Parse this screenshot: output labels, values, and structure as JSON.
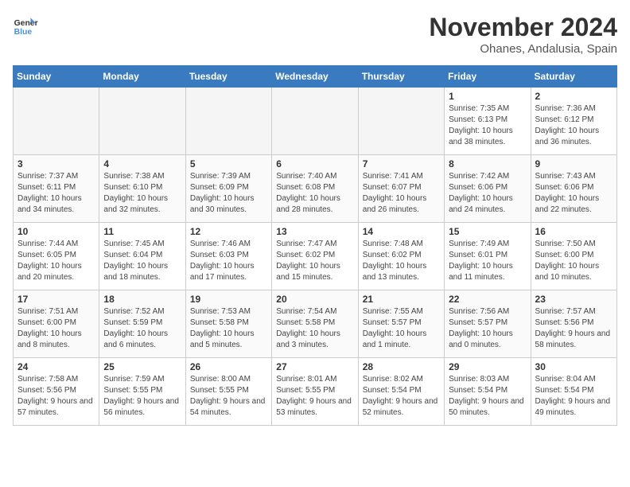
{
  "header": {
    "logo_general": "General",
    "logo_blue": "Blue",
    "month_title": "November 2024",
    "location": "Ohanes, Andalusia, Spain"
  },
  "days_of_week": [
    "Sunday",
    "Monday",
    "Tuesday",
    "Wednesday",
    "Thursday",
    "Friday",
    "Saturday"
  ],
  "weeks": [
    [
      {
        "day": "",
        "empty": true
      },
      {
        "day": "",
        "empty": true
      },
      {
        "day": "",
        "empty": true
      },
      {
        "day": "",
        "empty": true
      },
      {
        "day": "",
        "empty": true
      },
      {
        "day": "1",
        "sunrise": "7:35 AM",
        "sunset": "6:13 PM",
        "daylight": "10 hours and 38 minutes."
      },
      {
        "day": "2",
        "sunrise": "7:36 AM",
        "sunset": "6:12 PM",
        "daylight": "10 hours and 36 minutes."
      }
    ],
    [
      {
        "day": "3",
        "sunrise": "7:37 AM",
        "sunset": "6:11 PM",
        "daylight": "10 hours and 34 minutes."
      },
      {
        "day": "4",
        "sunrise": "7:38 AM",
        "sunset": "6:10 PM",
        "daylight": "10 hours and 32 minutes."
      },
      {
        "day": "5",
        "sunrise": "7:39 AM",
        "sunset": "6:09 PM",
        "daylight": "10 hours and 30 minutes."
      },
      {
        "day": "6",
        "sunrise": "7:40 AM",
        "sunset": "6:08 PM",
        "daylight": "10 hours and 28 minutes."
      },
      {
        "day": "7",
        "sunrise": "7:41 AM",
        "sunset": "6:07 PM",
        "daylight": "10 hours and 26 minutes."
      },
      {
        "day": "8",
        "sunrise": "7:42 AM",
        "sunset": "6:06 PM",
        "daylight": "10 hours and 24 minutes."
      },
      {
        "day": "9",
        "sunrise": "7:43 AM",
        "sunset": "6:06 PM",
        "daylight": "10 hours and 22 minutes."
      }
    ],
    [
      {
        "day": "10",
        "sunrise": "7:44 AM",
        "sunset": "6:05 PM",
        "daylight": "10 hours and 20 minutes."
      },
      {
        "day": "11",
        "sunrise": "7:45 AM",
        "sunset": "6:04 PM",
        "daylight": "10 hours and 18 minutes."
      },
      {
        "day": "12",
        "sunrise": "7:46 AM",
        "sunset": "6:03 PM",
        "daylight": "10 hours and 17 minutes."
      },
      {
        "day": "13",
        "sunrise": "7:47 AM",
        "sunset": "6:02 PM",
        "daylight": "10 hours and 15 minutes."
      },
      {
        "day": "14",
        "sunrise": "7:48 AM",
        "sunset": "6:02 PM",
        "daylight": "10 hours and 13 minutes."
      },
      {
        "day": "15",
        "sunrise": "7:49 AM",
        "sunset": "6:01 PM",
        "daylight": "10 hours and 11 minutes."
      },
      {
        "day": "16",
        "sunrise": "7:50 AM",
        "sunset": "6:00 PM",
        "daylight": "10 hours and 10 minutes."
      }
    ],
    [
      {
        "day": "17",
        "sunrise": "7:51 AM",
        "sunset": "6:00 PM",
        "daylight": "10 hours and 8 minutes."
      },
      {
        "day": "18",
        "sunrise": "7:52 AM",
        "sunset": "5:59 PM",
        "daylight": "10 hours and 6 minutes."
      },
      {
        "day": "19",
        "sunrise": "7:53 AM",
        "sunset": "5:58 PM",
        "daylight": "10 hours and 5 minutes."
      },
      {
        "day": "20",
        "sunrise": "7:54 AM",
        "sunset": "5:58 PM",
        "daylight": "10 hours and 3 minutes."
      },
      {
        "day": "21",
        "sunrise": "7:55 AM",
        "sunset": "5:57 PM",
        "daylight": "10 hours and 1 minute."
      },
      {
        "day": "22",
        "sunrise": "7:56 AM",
        "sunset": "5:57 PM",
        "daylight": "10 hours and 0 minutes."
      },
      {
        "day": "23",
        "sunrise": "7:57 AM",
        "sunset": "5:56 PM",
        "daylight": "9 hours and 58 minutes."
      }
    ],
    [
      {
        "day": "24",
        "sunrise": "7:58 AM",
        "sunset": "5:56 PM",
        "daylight": "9 hours and 57 minutes."
      },
      {
        "day": "25",
        "sunrise": "7:59 AM",
        "sunset": "5:55 PM",
        "daylight": "9 hours and 56 minutes."
      },
      {
        "day": "26",
        "sunrise": "8:00 AM",
        "sunset": "5:55 PM",
        "daylight": "9 hours and 54 minutes."
      },
      {
        "day": "27",
        "sunrise": "8:01 AM",
        "sunset": "5:55 PM",
        "daylight": "9 hours and 53 minutes."
      },
      {
        "day": "28",
        "sunrise": "8:02 AM",
        "sunset": "5:54 PM",
        "daylight": "9 hours and 52 minutes."
      },
      {
        "day": "29",
        "sunrise": "8:03 AM",
        "sunset": "5:54 PM",
        "daylight": "9 hours and 50 minutes."
      },
      {
        "day": "30",
        "sunrise": "8:04 AM",
        "sunset": "5:54 PM",
        "daylight": "9 hours and 49 minutes."
      }
    ]
  ]
}
